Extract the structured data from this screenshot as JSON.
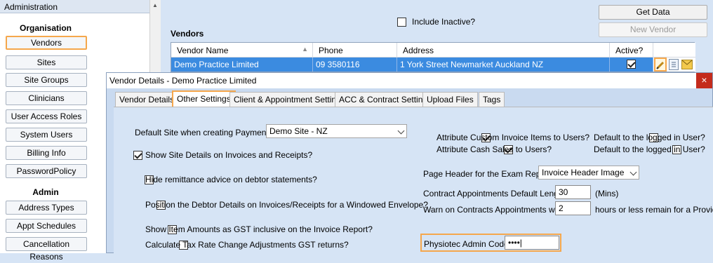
{
  "sidebar": {
    "header": "Administration",
    "section_org": "Organisation",
    "org_items": [
      "Vendors",
      "Sites",
      "Site Groups",
      "Clinicians",
      "User Access Roles",
      "System Users",
      "Billing Info",
      "PasswordPolicy"
    ],
    "section_admin": "Admin",
    "admin_items": [
      "Address Types",
      "Appt Schedules",
      "Cancellation Reasons"
    ],
    "selected": "Vendors"
  },
  "vendors": {
    "include_inactive_label": "Include Inactive?",
    "include_inactive_checked": false,
    "get_data_label": "Get Data",
    "new_vendor_label": "New Vendor",
    "section_title": "Vendors",
    "columns": [
      "Vendor Name",
      "Phone",
      "Address",
      "Active?"
    ],
    "rows": [
      {
        "name": "Demo Practice Limited",
        "phone": "09 3580116",
        "address": "1 York Street Newmarket Auckland NZ",
        "active": true
      }
    ],
    "row_icons": [
      "edit-icon",
      "document-icon",
      "mail-icon"
    ]
  },
  "dialog": {
    "title": "Vendor Details - Demo Practice Limited",
    "close_glyph": "×",
    "tabs": [
      "Vendor Details",
      "Other Settings",
      "Client & Appointment Settings",
      "ACC & Contract Settings",
      "Upload Files",
      "Tags"
    ],
    "active_tab": "Other Settings",
    "default_site_label": "Default Site when creating Payments",
    "default_site_value": "Demo Site - NZ",
    "show_site_details_label": "Show Site Details on Invoices and Receipts?",
    "show_site_details_checked": true,
    "hide_remittance_label": "Hide remittance advice on debtor statements?",
    "hide_remittance_checked": false,
    "position_debtor_label": "Position the Debtor Details on Invoices/Receipts for a Windowed Envelope?",
    "position_debtor_checked": false,
    "gst_inclusive_label": "Show Item Amounts as GST inclusive on the Invoice Report?",
    "gst_inclusive_checked": false,
    "tax_rate_label": "Calculate Tax Rate Change Adjustments GST returns?",
    "tax_rate_checked": false,
    "attr_custom_label": "Attribute Custom Invoice Items to Users?",
    "attr_custom_checked": true,
    "attr_cash_label": "Attribute Cash Sales to Users?",
    "attr_cash_checked": true,
    "default_logged_label_1": "Default to the logged in User?",
    "default_logged_checked_1": false,
    "default_logged_label_2": "Default to the logged in User?",
    "default_logged_checked_2": false,
    "page_header_label": "Page Header for the Exam Report",
    "page_header_value": "Invoice Header Image",
    "contract_length_label": "Contract Appointments Default Length",
    "contract_length_value": "30",
    "contract_length_unit": "(Mins)",
    "warn_label": "Warn on Contracts Appointments when",
    "warn_value": "2",
    "warn_suffix": "hours or less remain for a Provider",
    "physiotec_label": "Physiotec Admin Code",
    "physiotec_value": "••••|"
  },
  "colors": {
    "highlight": "#f5a74c",
    "selected_row": "#3b8be0",
    "panel_bg": "#d6e4f5",
    "close_red": "#c42b1c"
  }
}
